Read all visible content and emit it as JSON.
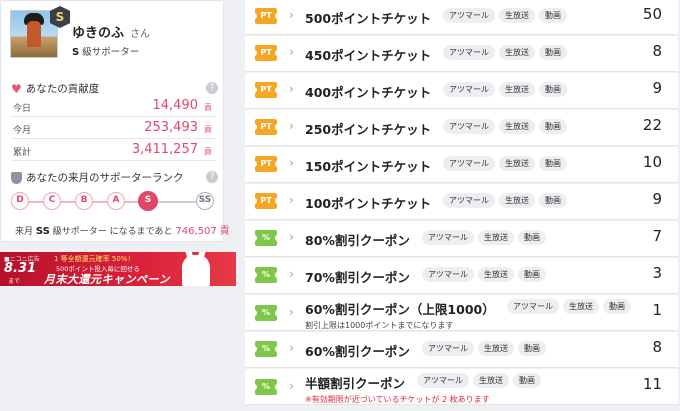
{
  "profile": {
    "username": "ゆきのふ",
    "honorific": "さん",
    "rank_badge": "S",
    "rank_letter": "S",
    "rank_label": "級サポーター"
  },
  "contribution": {
    "title": "あなたの貢献度",
    "help": "?",
    "rows": [
      {
        "label": "今日",
        "value": "14,490",
        "unit": "貢"
      },
      {
        "label": "今月",
        "value": "253,493",
        "unit": "貢"
      },
      {
        "label": "累計",
        "value": "3,411,257",
        "unit": "貢"
      }
    ]
  },
  "next_rank": {
    "title": "あなたの来月のサポーターランク",
    "help": "?",
    "ladder": [
      "D",
      "C",
      "B",
      "A",
      "S",
      "SS"
    ],
    "current_index": 4,
    "prefix": "来月",
    "target_rank": "SS",
    "target_label": "級サポーター",
    "mid": "になるまであと",
    "remaining": "746,507",
    "unit": "貢"
  },
  "banner": {
    "brand": "■ニコニ広告",
    "date": "8.31",
    "made": "まで",
    "line1": "1 等全額還元確率 50%！",
    "line2": "500ポイント投入毎に回せる",
    "title": "月末大還元キャンペーン"
  },
  "tickets": [
    {
      "icon": "PT",
      "kind": "pt",
      "name": "500ポイントチケット",
      "tags": [
        "アツマール",
        "生放送",
        "動画"
      ],
      "count": "50",
      "note": ""
    },
    {
      "icon": "PT",
      "kind": "pt",
      "name": "450ポイントチケット",
      "tags": [
        "アツマール",
        "生放送",
        "動画"
      ],
      "count": "8",
      "note": ""
    },
    {
      "icon": "PT",
      "kind": "pt",
      "name": "400ポイントチケット",
      "tags": [
        "アツマール",
        "生放送",
        "動画"
      ],
      "count": "9",
      "note": ""
    },
    {
      "icon": "PT",
      "kind": "pt",
      "name": "250ポイントチケット",
      "tags": [
        "アツマール",
        "生放送",
        "動画"
      ],
      "count": "22",
      "note": ""
    },
    {
      "icon": "PT",
      "kind": "pt",
      "name": "150ポイントチケット",
      "tags": [
        "アツマール",
        "生放送",
        "動画"
      ],
      "count": "10",
      "note": ""
    },
    {
      "icon": "PT",
      "kind": "pt",
      "name": "100ポイントチケット",
      "tags": [
        "アツマール",
        "生放送",
        "動画"
      ],
      "count": "9",
      "note": ""
    },
    {
      "icon": "%",
      "kind": "pct",
      "name": "80%割引クーポン",
      "tags": [
        "アツマール",
        "生放送",
        "動画"
      ],
      "count": "7",
      "note": ""
    },
    {
      "icon": "%",
      "kind": "pct",
      "name": "70%割引クーポン",
      "tags": [
        "アツマール",
        "生放送",
        "動画"
      ],
      "count": "3",
      "note": ""
    },
    {
      "icon": "%",
      "kind": "pct",
      "name": "60%割引クーポン（上限1000）",
      "tags": [
        "アツマール",
        "生放送",
        "動画"
      ],
      "count": "1",
      "note": "割引上限は1000ポイントまでになります"
    },
    {
      "icon": "%",
      "kind": "pct",
      "name": "60%割引クーポン",
      "tags": [
        "アツマール",
        "生放送",
        "動画"
      ],
      "count": "8",
      "note": ""
    },
    {
      "icon": "%",
      "kind": "pct",
      "name": "半額割引クーポン",
      "tags": [
        "アツマール",
        "生放送",
        "動画"
      ],
      "count": "11",
      "note": "※有効期限が近づいているチケットが 2 枚あります",
      "note_style": "red"
    }
  ],
  "colors": {
    "accent": "#e0486a",
    "pt_ticket": "#f5a623",
    "pct_ticket": "#7ec748"
  }
}
